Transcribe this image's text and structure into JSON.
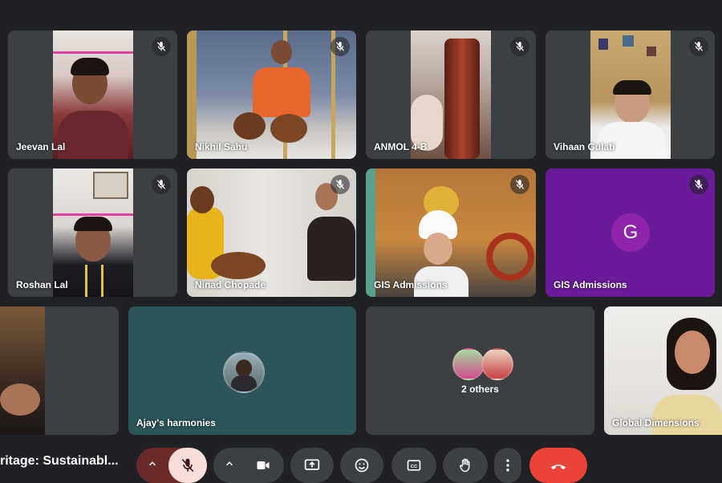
{
  "meeting": {
    "title": "ritage: Sustainabl..."
  },
  "participants": [
    {
      "name": "Jeevan Lal",
      "muted": true
    },
    {
      "name": "Nikhil Sahu",
      "muted": true
    },
    {
      "name": "ANMOL 4-B",
      "muted": true
    },
    {
      "name": "Vihaan Gulati",
      "muted": true
    },
    {
      "name": "Roshan Lal",
      "muted": true
    },
    {
      "name": "Ninad Chopade",
      "muted": true
    },
    {
      "name": "GIS Admissions",
      "muted": true
    },
    {
      "name": "GIS Admissions",
      "muted": true,
      "initial": "G"
    },
    {
      "name": ""
    },
    {
      "name": "Ajay's harmonies"
    },
    {
      "name": "",
      "others_label": "2 others"
    },
    {
      "name": "Global Dimensions"
    }
  ],
  "colors": {
    "background": "#202124",
    "tile": "#3c4043",
    "purple_tile": "#6a1b9a",
    "teal_tile": "#2b5558",
    "mic_off_active": "#f9dedc",
    "end_call": "#ea4335"
  },
  "controls": {
    "mic": {
      "icon": "mic-off-icon",
      "muted": true
    },
    "camera": {
      "icon": "video-camera-icon"
    },
    "present": {
      "icon": "present-screen-icon"
    },
    "reactions": {
      "icon": "emoji-icon"
    },
    "captions": {
      "icon": "closed-captions-icon"
    },
    "raise_hand": {
      "icon": "raise-hand-icon"
    },
    "more": {
      "icon": "more-options-icon"
    },
    "end_call": {
      "icon": "hang-up-icon"
    }
  }
}
